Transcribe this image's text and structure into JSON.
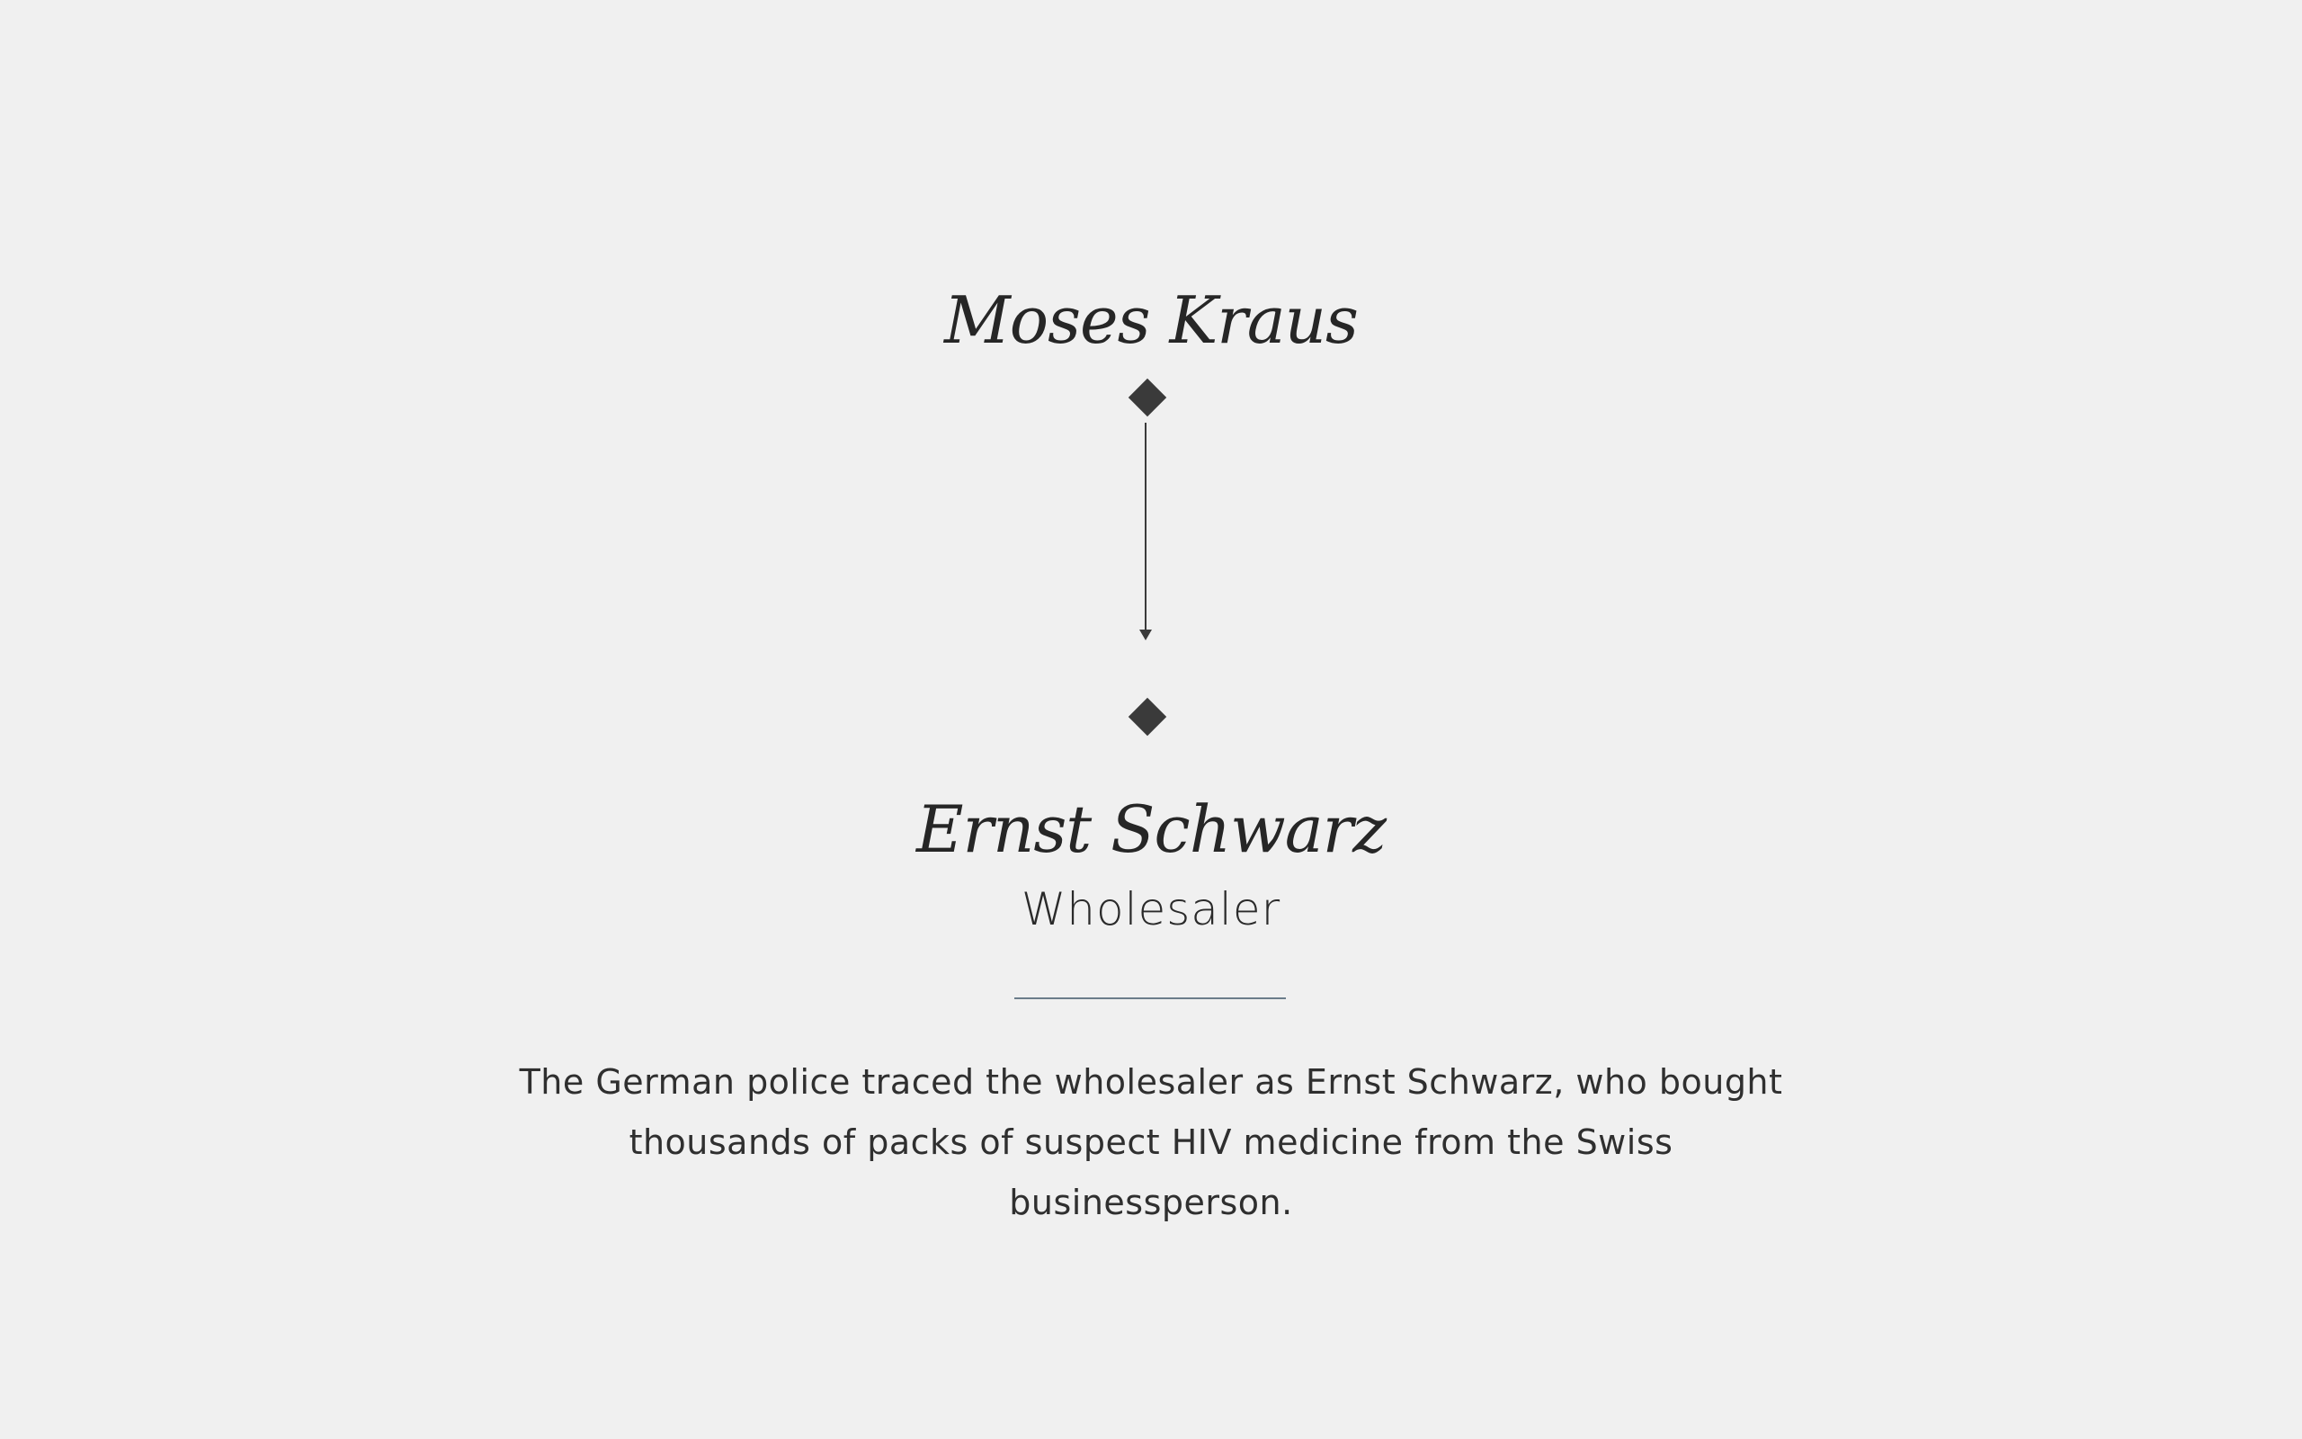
{
  "source_node": {
    "name": "Moses Kraus",
    "marker_icon": "diamond-icon"
  },
  "target_node": {
    "name": "Ernst Schwarz",
    "role": "Wholesaler",
    "marker_icon": "diamond-icon"
  },
  "connection": {
    "arrow_icon": "arrow-down-icon"
  },
  "description": "The German police traced the wholesaler as Ernst Schwarz, who bought thousands of packs of suspect HIV medicine from the Swiss businessperson.",
  "colors": {
    "background": "#f0f0f0",
    "text": "#262626",
    "marker": "#3a3a3a",
    "divider": "#6b7d8a"
  }
}
